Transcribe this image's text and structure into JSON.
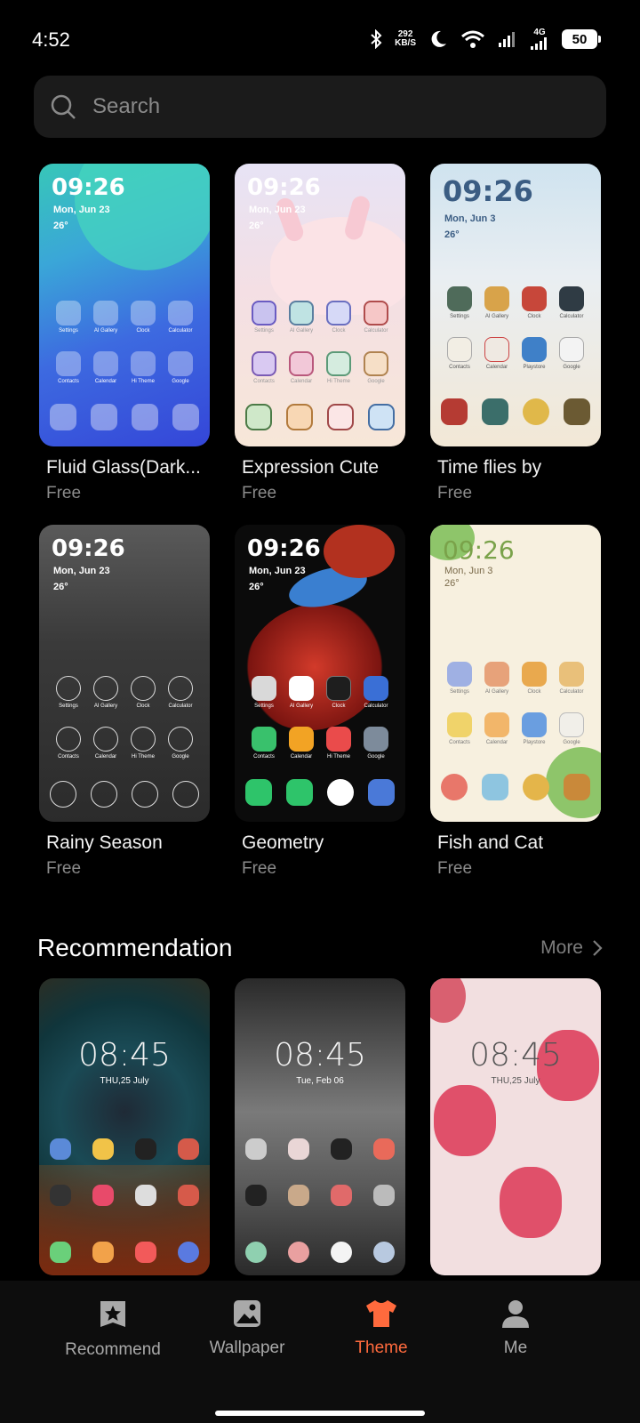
{
  "status": {
    "time": "4:52",
    "net_speed_value": "292",
    "net_speed_unit": "KB/S",
    "network": "4G",
    "battery": "50"
  },
  "search": {
    "placeholder": "Search"
  },
  "themes": [
    {
      "name": "Fluid Glass(Dark...",
      "price": "Free",
      "clock": "09:26",
      "date": "Mon, Jun 23",
      "temp": "26°"
    },
    {
      "name": "Expression Cute",
      "price": "Free",
      "clock": "09:26",
      "date": "Mon, Jun 23",
      "temp": "26°"
    },
    {
      "name": "Time flies by",
      "price": "Free",
      "clock": "09:26",
      "date": "Mon, Jun 3",
      "temp": "26°"
    },
    {
      "name": "Rainy Season",
      "price": "Free",
      "clock": "09:26",
      "date": "Mon, Jun 23",
      "temp": "26°"
    },
    {
      "name": "Geometry",
      "price": "Free",
      "clock": "09:26",
      "date": "Mon, Jun 23",
      "temp": "26°"
    },
    {
      "name": "Fish and Cat",
      "price": "Free",
      "clock": "09:26",
      "date": "Mon, Jun 3",
      "temp": "26°"
    }
  ],
  "app_labels": [
    "Settings",
    "AI Gallery",
    "Clock",
    "Calculator",
    "Contacts",
    "Calendar",
    "Hi Theme",
    "Google"
  ],
  "app_labels_alt": [
    "Settings",
    "AI Gallery",
    "Clock",
    "Calculator",
    "Contacts",
    "Calendar",
    "Playstore",
    "Google"
  ],
  "recommendation": {
    "title": "Recommendation",
    "more": "More",
    "items": [
      {
        "clock": "08:45",
        "date": "THU,25 July"
      },
      {
        "clock": "08:45",
        "date": "Tue, Feb 06"
      },
      {
        "clock": "08:45",
        "date": "THU,25 July"
      }
    ]
  },
  "nav": {
    "recommend": "Recommend",
    "wallpaper": "Wallpaper",
    "theme": "Theme",
    "me": "Me"
  },
  "colors": {
    "accent": "#ff6a3d",
    "background": "#000000"
  }
}
